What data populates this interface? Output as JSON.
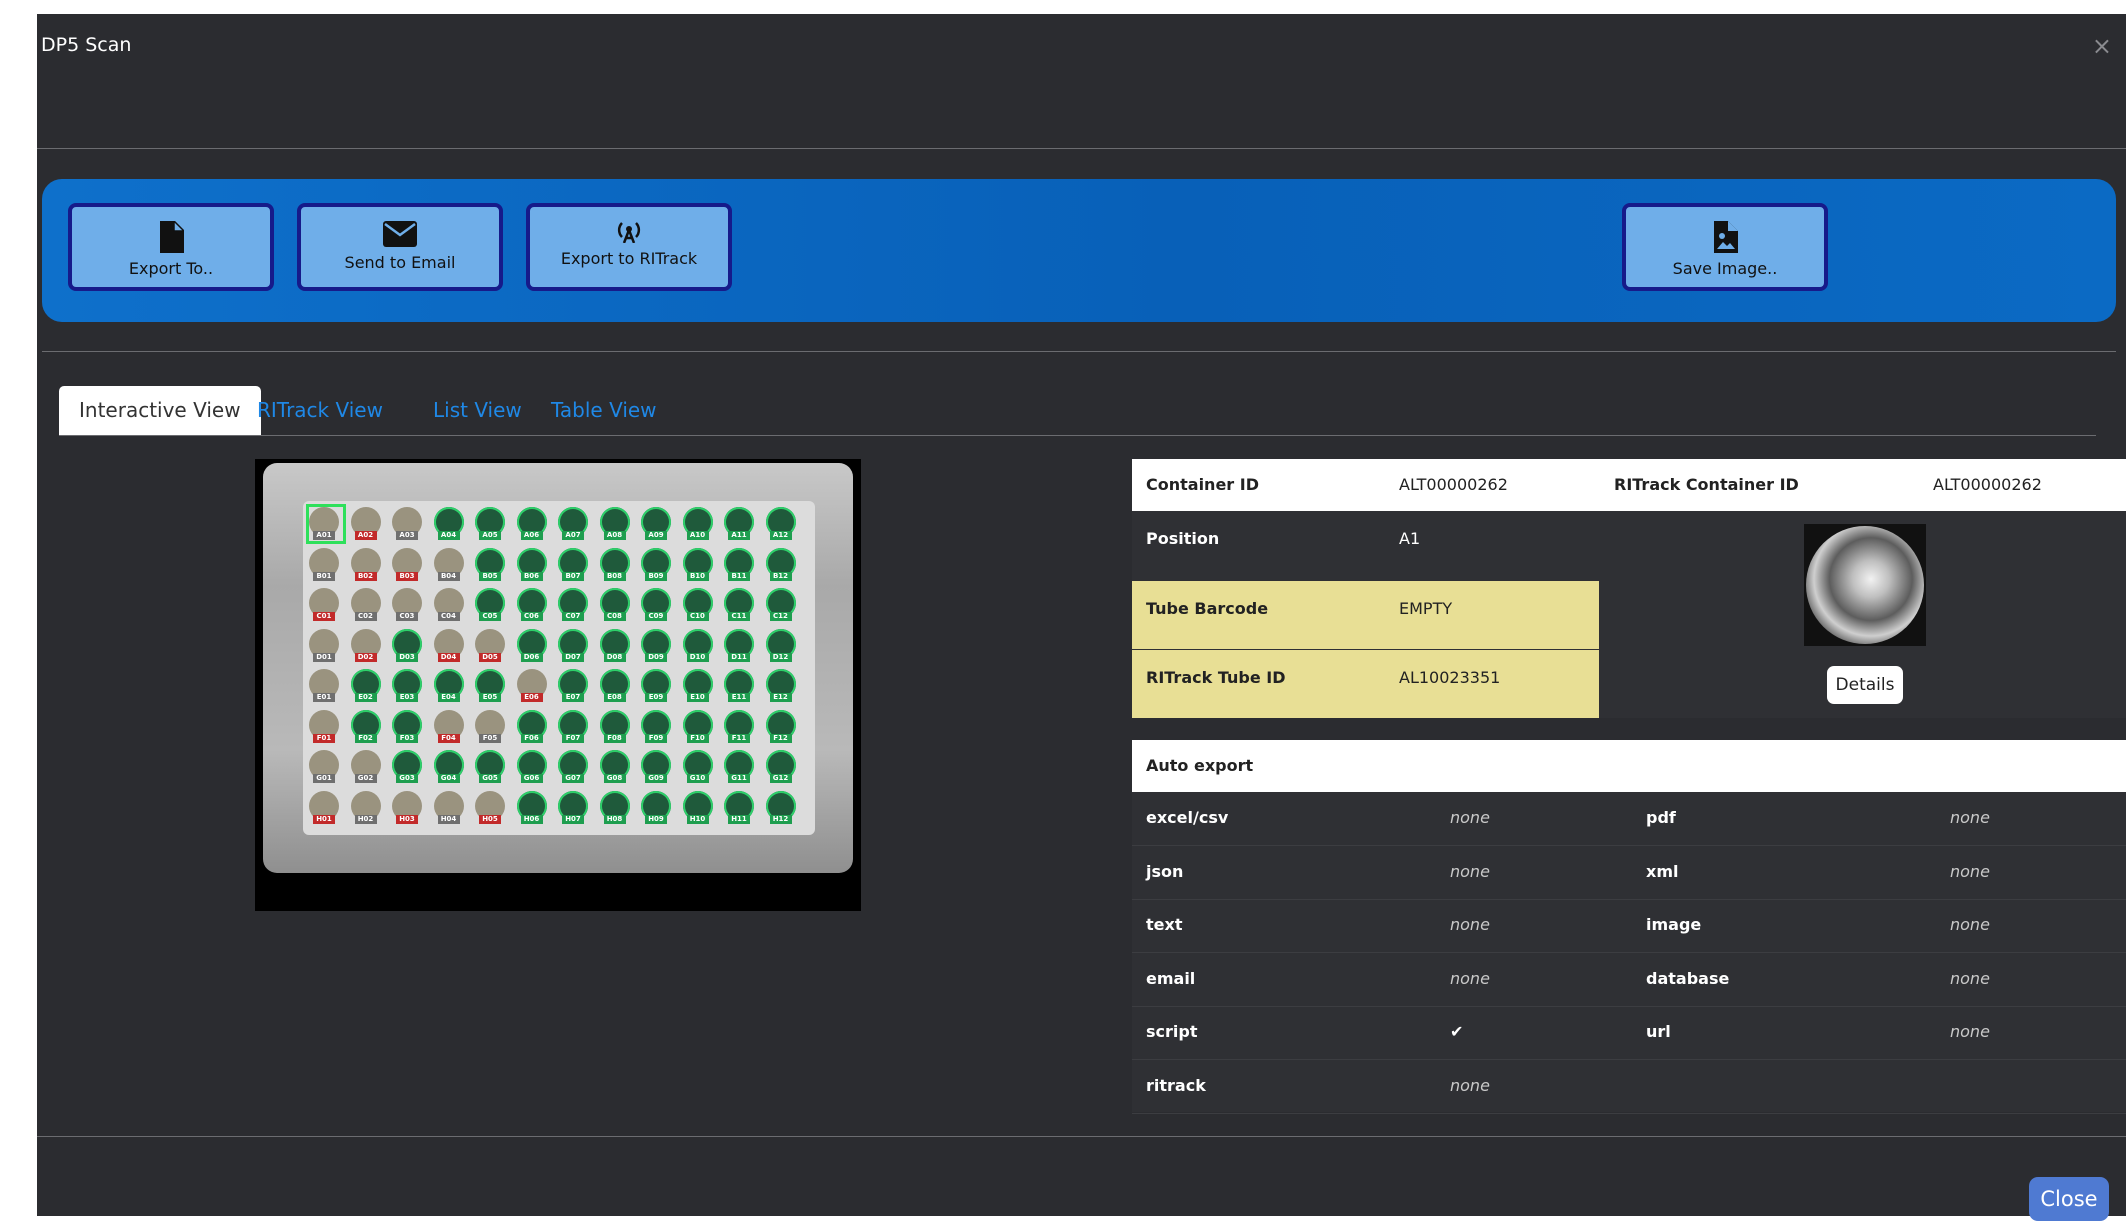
{
  "window": {
    "title": "DP5 Scan",
    "close_symbol": "×"
  },
  "toolbar": {
    "export_label": "Export To..",
    "email_label": "Send to Email",
    "ritrack_label": "Export to RITrack",
    "save_label": "Save Image.."
  },
  "tabs": [
    {
      "label": "Interactive View",
      "active": true
    },
    {
      "label": "RITrack View",
      "active": false
    },
    {
      "label": "List View",
      "active": false
    },
    {
      "label": "Table View",
      "active": false
    }
  ],
  "plate": {
    "rows": [
      "A",
      "B",
      "C",
      "D",
      "E",
      "F",
      "G",
      "H"
    ],
    "cols": [
      "01",
      "02",
      "03",
      "04",
      "05",
      "06",
      "07",
      "08",
      "09",
      "10",
      "11",
      "12"
    ],
    "selected": "A01",
    "status": {
      "A": "nrnggggggggg",
      "B": "nrrngggggggg",
      "C": "rnnngggggggg",
      "D": "nrgrrggggggg",
      "E": "nggggrgggggg",
      "F": "rggrnggggggg",
      "G": "nngggggggggg",
      "H": "rnrnrggggggg"
    }
  },
  "info": {
    "container_id_label": "Container ID",
    "container_id": "ALT00000262",
    "ritrack_container_id_label": "RITrack Container ID",
    "ritrack_container_id": "ALT00000262",
    "position_label": "Position",
    "position": "A1",
    "tube_barcode_label": "Tube Barcode",
    "tube_barcode": "EMPTY",
    "ritrack_tube_id_label": "RITrack Tube ID",
    "ritrack_tube_id": "AL10023351",
    "details_label": "Details"
  },
  "auto_export": {
    "header": "Auto export",
    "rows": [
      [
        {
          "label": "excel/csv",
          "value": "none"
        },
        {
          "label": "pdf",
          "value": "none"
        }
      ],
      [
        {
          "label": "json",
          "value": "none"
        },
        {
          "label": "xml",
          "value": "none"
        }
      ],
      [
        {
          "label": "text",
          "value": "none"
        },
        {
          "label": "image",
          "value": "none"
        }
      ],
      [
        {
          "label": "email",
          "value": "none"
        },
        {
          "label": "database",
          "value": "none"
        }
      ],
      [
        {
          "label": "script",
          "value": "✔"
        },
        {
          "label": "url",
          "value": "none"
        }
      ],
      [
        {
          "label": "ritrack",
          "value": "none"
        }
      ]
    ]
  },
  "footer": {
    "close_label": "Close"
  },
  "colors": {
    "modal_bg": "#2b2c30",
    "toolbar_blue": "#0b6ac4",
    "button_face": "#6faee9",
    "button_border": "#161a8a",
    "highlight_yellow": "#e8df95",
    "tab_link": "#1f88e6",
    "close_button": "#4f7ad2",
    "well_ok": "#1e9e4f",
    "well_error": "#c22a2a"
  },
  "icons": {
    "export": "file-icon",
    "email": "envelope-icon",
    "ritrack": "antenna-icon",
    "save": "file-image-icon"
  }
}
